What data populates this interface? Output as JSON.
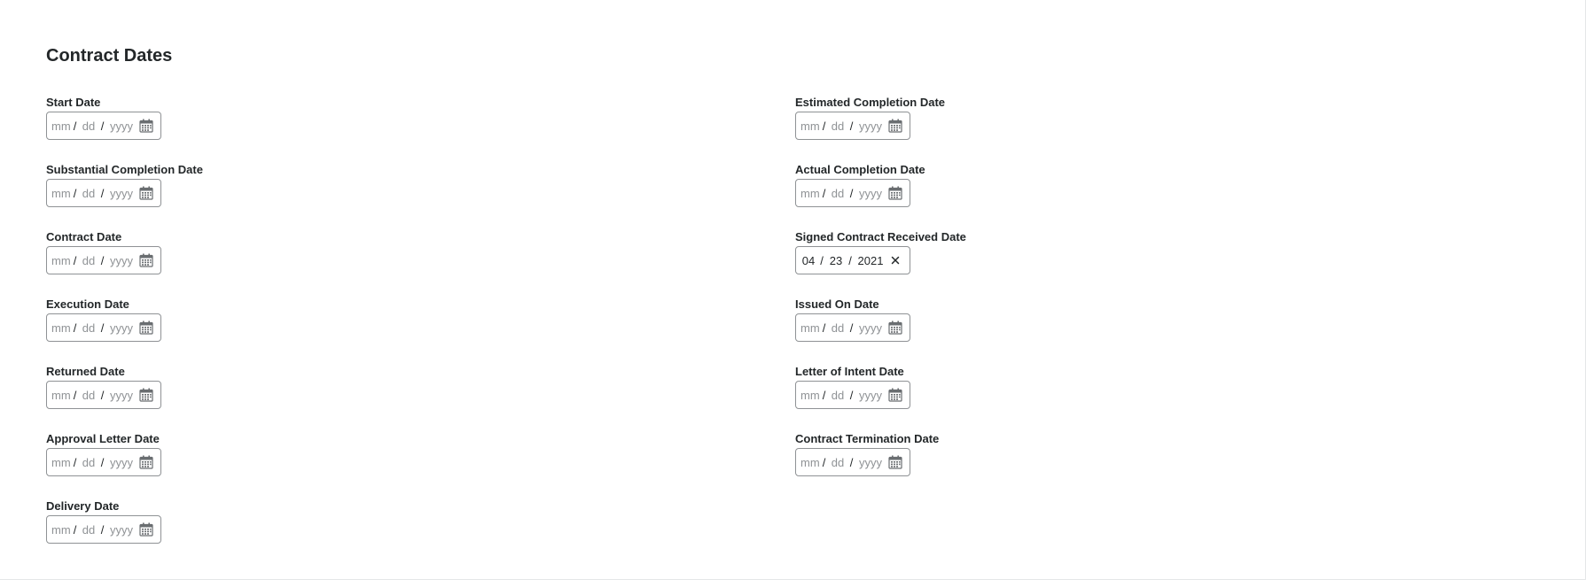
{
  "section": {
    "title": "Contract Dates"
  },
  "placeholders": {
    "mm": "mm",
    "dd": "dd",
    "yyyy": "yyyy",
    "sep": "/"
  },
  "left_fields": [
    {
      "label": "Start Date"
    },
    {
      "label": "Substantial Completion Date"
    },
    {
      "label": "Contract Date"
    },
    {
      "label": "Execution Date"
    },
    {
      "label": "Returned Date"
    },
    {
      "label": "Approval Letter Date"
    },
    {
      "label": "Delivery Date"
    }
  ],
  "right_fields": [
    {
      "label": "Estimated Completion Date"
    },
    {
      "label": "Actual Completion Date"
    },
    {
      "label": "Signed Contract Received Date",
      "value": {
        "mm": "04",
        "dd": "23",
        "yyyy": "2021"
      }
    },
    {
      "label": "Issued On Date"
    },
    {
      "label": "Letter of Intent Date"
    },
    {
      "label": "Contract Termination Date"
    }
  ],
  "icons": {
    "calendar": "calendar-icon",
    "clear": "clear-icon"
  },
  "colors": {
    "border": "#8f9295",
    "placeholder": "#8f9295",
    "text": "#232729"
  }
}
